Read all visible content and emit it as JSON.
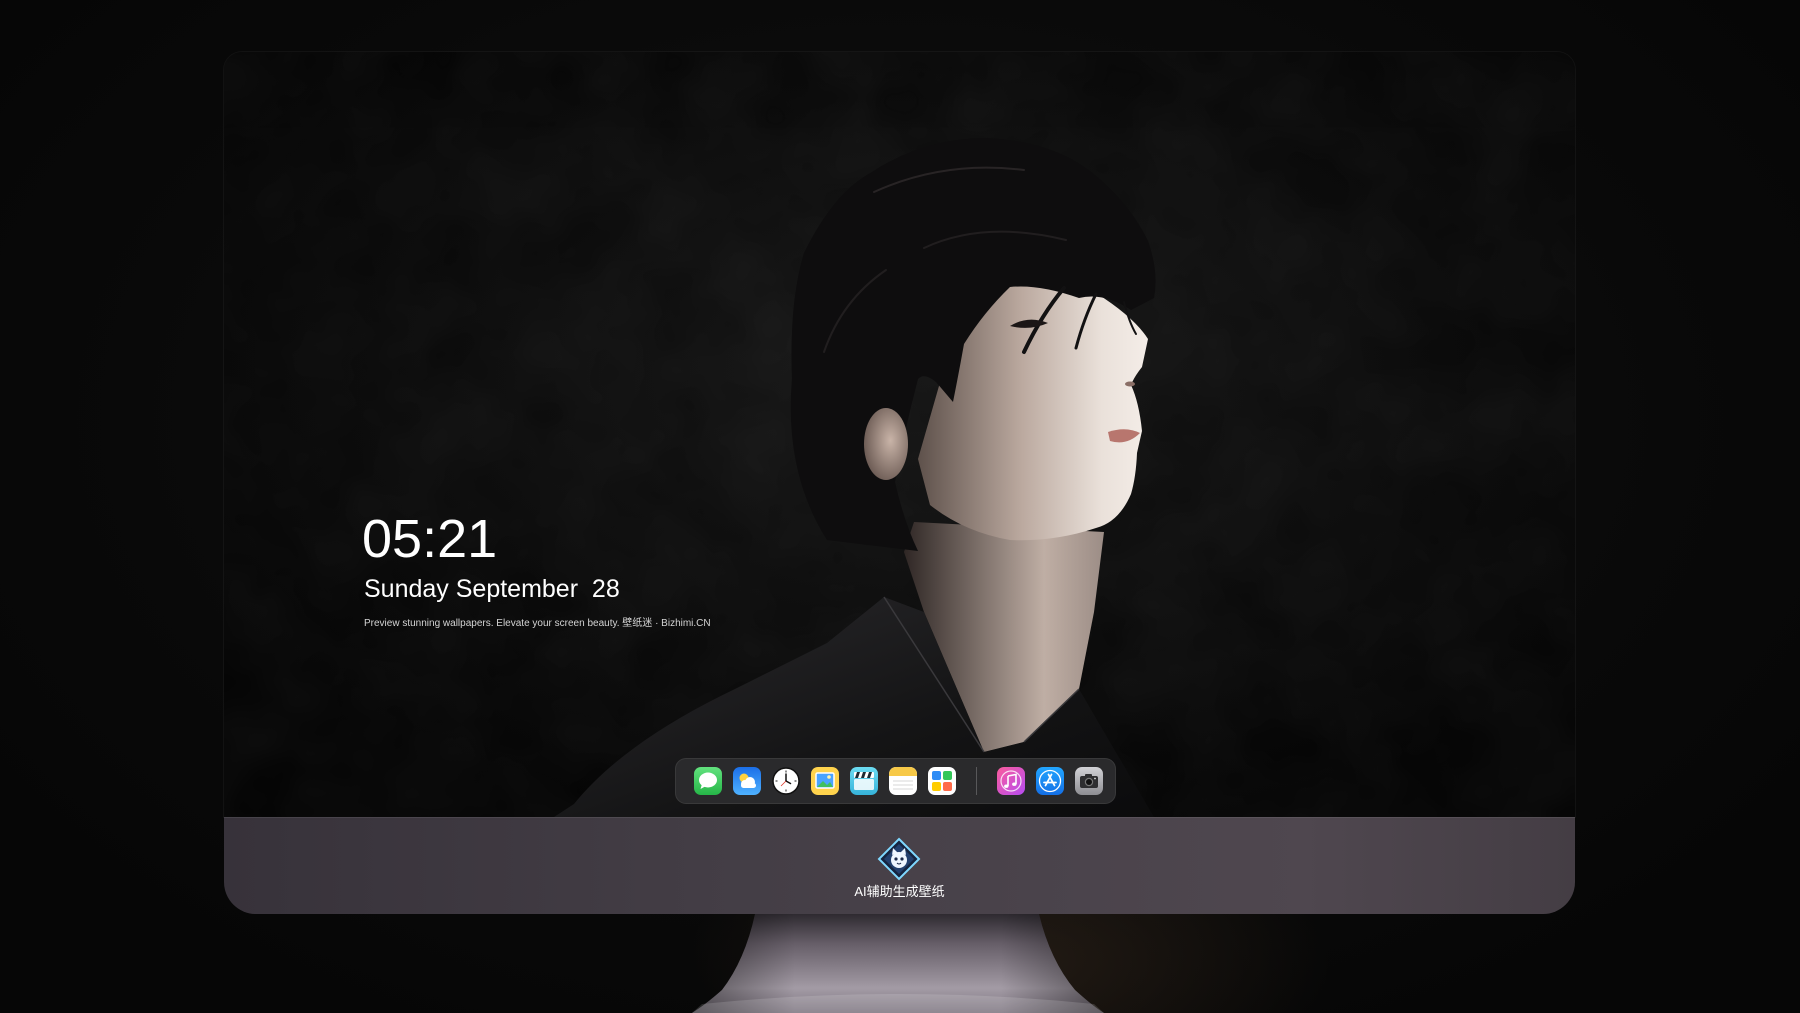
{
  "lockscreen": {
    "time": "05:21",
    "date": "Sunday September  28",
    "tagline": "Preview stunning wallpapers. Elevate your screen beauty. 壁纸迷 · Bizhimi.CN"
  },
  "dock": {
    "apps": [
      {
        "icon": "messages-icon",
        "color": "#34c759"
      },
      {
        "icon": "weather-icon",
        "color": "#2a8cf5"
      },
      {
        "icon": "clock-icon",
        "color": "#ffffff"
      },
      {
        "icon": "preview-icon",
        "color": "#ffd34d"
      },
      {
        "icon": "clips-icon",
        "color": "#4cc6e6"
      },
      {
        "icon": "notes-icon",
        "color": "#f7c948"
      },
      {
        "icon": "app-grid-icon",
        "color": "#ffffff"
      }
    ],
    "apps_after_separator": [
      {
        "icon": "music-icon",
        "color": "#f24fb0"
      },
      {
        "icon": "app-store-icon",
        "color": "#1c8cf6"
      },
      {
        "icon": "camera-icon",
        "color": "#9a9a9e"
      }
    ]
  },
  "chin": {
    "logo_icon": "ai-wallpaper-logo-icon",
    "caption": "AI辅助生成壁纸"
  },
  "colors": {
    "page_background": "#0a0a0a",
    "dock_background": "#2a2a2c",
    "chin": "#48424a",
    "stand": "#8d8590",
    "text": "#ffffff"
  }
}
